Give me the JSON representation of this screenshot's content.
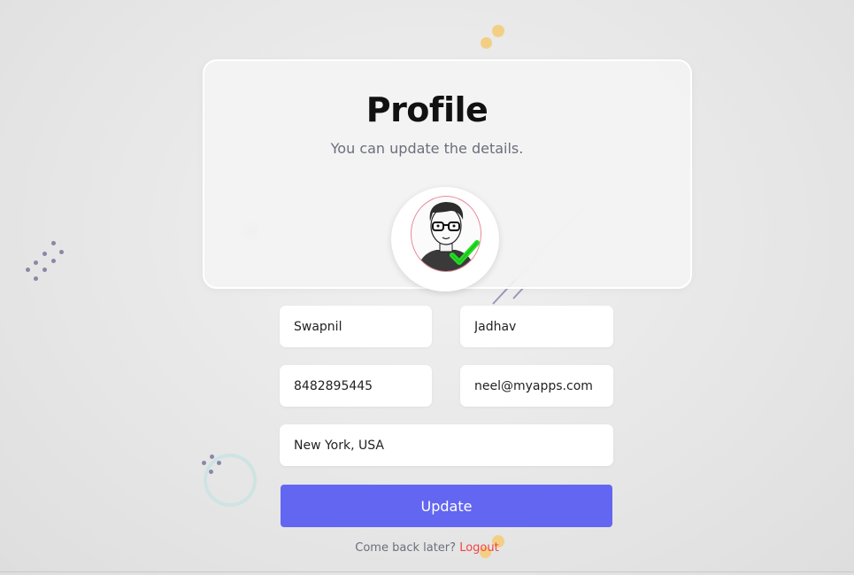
{
  "header": {
    "title": "Profile",
    "subtitle": "You can update the details."
  },
  "avatar": {
    "icon": "avatar-verified-icon",
    "check_color": "#22dd22"
  },
  "form": {
    "first_name": "Swapnil",
    "last_name": "Jadhav",
    "phone": "8482895445",
    "email": "neel@myapps.com",
    "location": "New York, USA"
  },
  "actions": {
    "update_label": "Update"
  },
  "footer": {
    "prompt": "Come back later? ",
    "logout_label": "Logout"
  },
  "colors": {
    "accent": "#6366f1",
    "logout": "#ef4444",
    "deco_yellow": "#f3cf86",
    "deco_purple": "#8a87a8",
    "deco_ring": "#cfe3e3"
  }
}
